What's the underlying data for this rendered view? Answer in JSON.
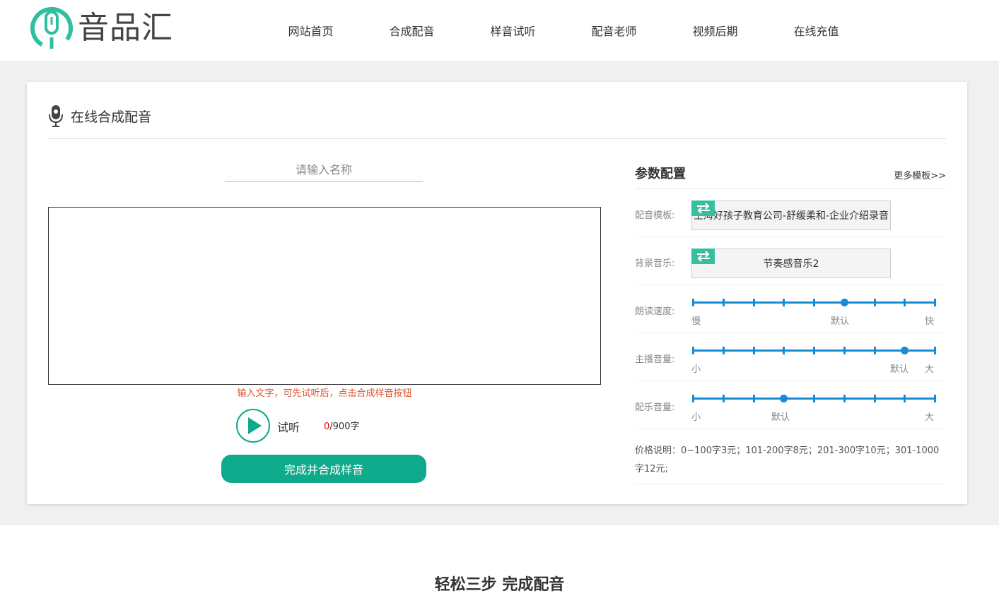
{
  "brand": {
    "name": "音品汇",
    "accent": "#2dbf9f"
  },
  "nav": [
    {
      "label": "网站首页"
    },
    {
      "label": "合成配音"
    },
    {
      "label": "样音试听"
    },
    {
      "label": "配音老师"
    },
    {
      "label": "视频后期"
    },
    {
      "label": "在线充值"
    }
  ],
  "card": {
    "title": "在线合成配音",
    "icon": "microphone-icon"
  },
  "editor": {
    "name_placeholder": "请输入名称",
    "text_value": "",
    "hint": "输入文字，可先试听后，点击合成样音按钮",
    "listen_label": "试听",
    "char_count": "0",
    "char_limit": "/900字",
    "submit_label": "完成并合成样音"
  },
  "params": {
    "title": "参数配置",
    "more_link": "更多模板>>",
    "template": {
      "label": "配音模板:",
      "value": "上海好孩子教育公司-舒缓柔和-企业介绍录音"
    },
    "bgm": {
      "label": "背景音乐:",
      "value": "节奏感音乐2"
    },
    "speed": {
      "label": "朗读速度:",
      "min_label": "慢",
      "default_label": "默认",
      "max_label": "快",
      "value_step": 5,
      "steps": 8
    },
    "host_volume": {
      "label": "主播音量:",
      "min_label": "小",
      "default_label": "默认",
      "max_label": "大",
      "value_step": 7,
      "steps": 8
    },
    "music_volume": {
      "label": "配乐音量:",
      "min_label": "小",
      "default_label": "默认",
      "max_label": "大",
      "value_step": 3,
      "steps": 8
    },
    "price_note": "价格说明：0~100字3元；101-200字8元；201-300字10元；301-1000字12元;"
  },
  "footer": {
    "title": "轻松三步 完成配音"
  },
  "colors": {
    "primary_button": "#0fa98b",
    "slider": "#1a8ad8",
    "hint": "#e0502a",
    "swap_badge": "#35bfa0"
  }
}
